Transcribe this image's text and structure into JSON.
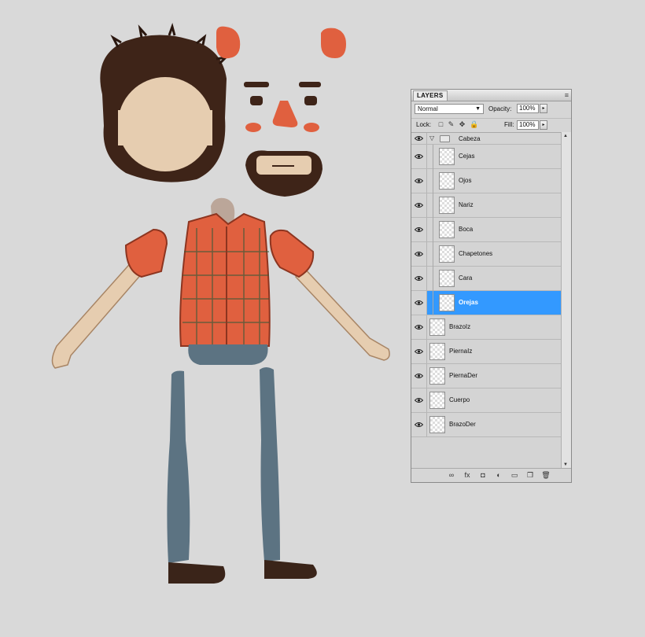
{
  "panel": {
    "tab": "LAYERS",
    "menu_icon": "panel-menu-icon",
    "blend_mode": "Normal",
    "opacity_label": "Opacity:",
    "opacity_value": "100%",
    "lock_label": "Lock:",
    "fill_label": "Fill:",
    "fill_value": "100%"
  },
  "group": {
    "name": "Cabeza",
    "expanded": true
  },
  "layers": [
    {
      "name": "Cejas",
      "in_group": true,
      "selected": false
    },
    {
      "name": "Ojos",
      "in_group": true,
      "selected": false
    },
    {
      "name": "Nariz",
      "in_group": true,
      "selected": false
    },
    {
      "name": "Boca",
      "in_group": true,
      "selected": false
    },
    {
      "name": "Chapetones",
      "in_group": true,
      "selected": false
    },
    {
      "name": "Cara",
      "in_group": true,
      "selected": false
    },
    {
      "name": "Orejas",
      "in_group": true,
      "selected": true
    },
    {
      "name": "BrazoIz",
      "in_group": false,
      "selected": false
    },
    {
      "name": "PiernaIz",
      "in_group": false,
      "selected": false
    },
    {
      "name": "PiernaDer",
      "in_group": false,
      "selected": false
    },
    {
      "name": "Cuerpo",
      "in_group": false,
      "selected": false
    },
    {
      "name": "BrazoDer",
      "in_group": false,
      "selected": false
    }
  ],
  "footer_icons": [
    "link-icon",
    "fx-icon",
    "mask-icon",
    "adjustment-icon",
    "new-group-icon",
    "new-layer-icon",
    "trash-icon"
  ],
  "colors": {
    "selection": "#3399ff",
    "shirt": "#e0603f",
    "hair": "#3e2418",
    "skin": "#e6cdb0",
    "jeans": "#5c7382"
  }
}
